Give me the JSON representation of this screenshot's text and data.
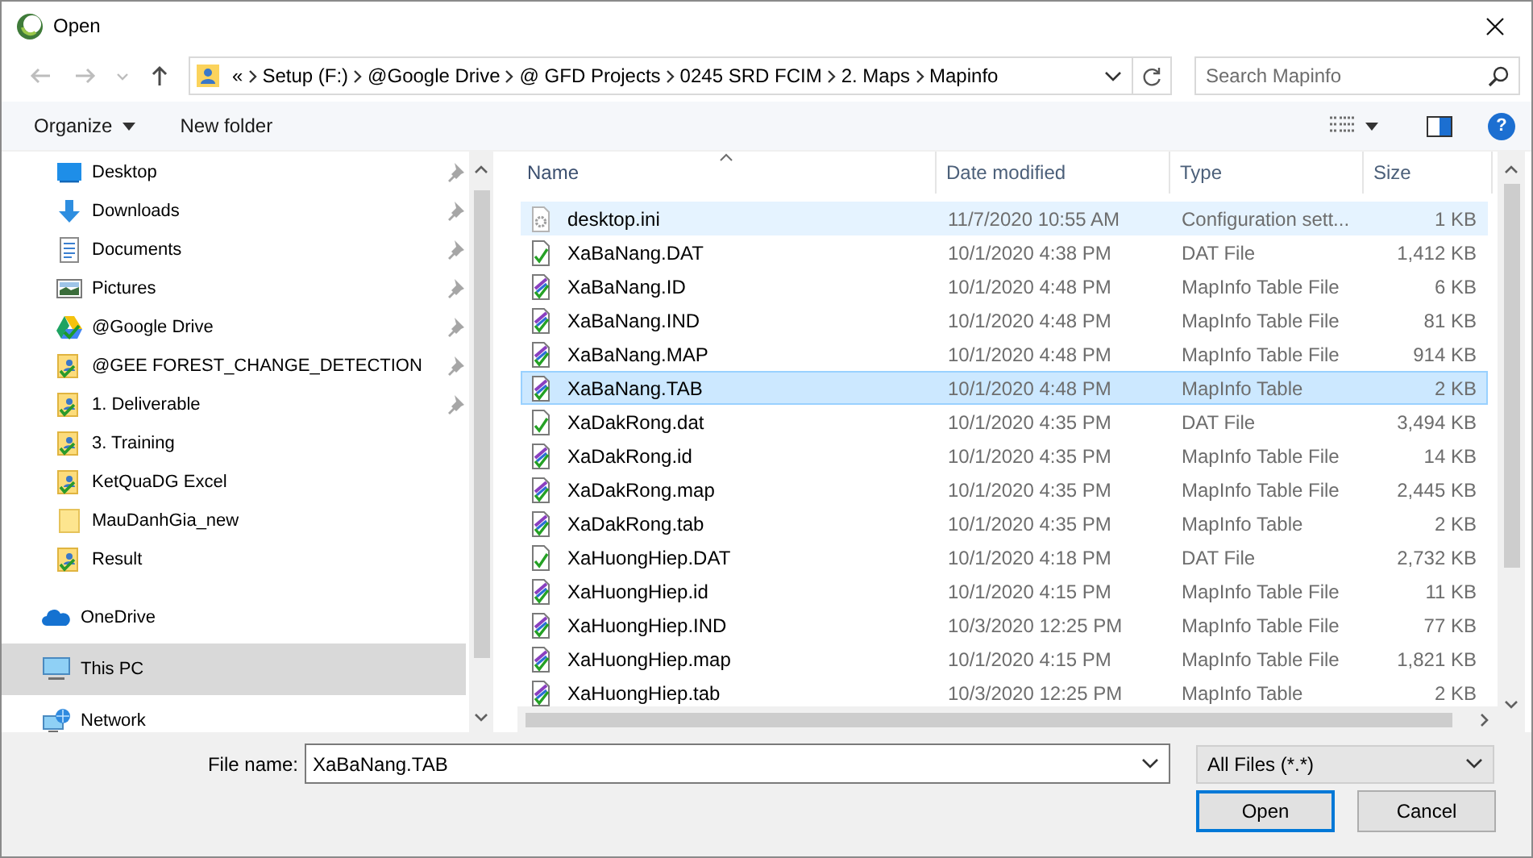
{
  "window": {
    "title": "Open"
  },
  "nav_buttons": [
    {
      "kind": "back",
      "disabled": true
    },
    {
      "kind": "forward",
      "disabled": true
    },
    {
      "kind": "recent",
      "disabled": true
    },
    {
      "kind": "up",
      "disabled": false
    }
  ],
  "address": {
    "overflow": "«",
    "crumbs": [
      "Setup (F:)",
      "@Google Drive",
      "@ GFD Projects",
      "0245 SRD FCIM",
      "2. Maps",
      "Mapinfo"
    ]
  },
  "search": {
    "placeholder": "Search Mapinfo"
  },
  "toolbar": {
    "organize": "Organize",
    "new_folder": "New folder",
    "help": "?"
  },
  "sidebar": {
    "quick_access": [
      {
        "label": "Desktop",
        "kind": "desktop",
        "pinned": true,
        "selected": false
      },
      {
        "label": "Downloads",
        "kind": "downloads",
        "pinned": true,
        "selected": false
      },
      {
        "label": "Documents",
        "kind": "documents",
        "pinned": true,
        "selected": false
      },
      {
        "label": "Pictures",
        "kind": "pictures",
        "pinned": true,
        "selected": false
      },
      {
        "label": "@Google Drive",
        "kind": "drive",
        "pinned": true,
        "selected": false
      },
      {
        "label": "@GEE FOREST_CHANGE_DETECTION",
        "kind": "synced-folder",
        "pinned": true,
        "selected": false
      },
      {
        "label": "1. Deliverable",
        "kind": "synced-folder",
        "pinned": true,
        "selected": false
      },
      {
        "label": "3. Training",
        "kind": "synced-folder",
        "pinned": false,
        "selected": false
      },
      {
        "label": "KetQuaDG Excel",
        "kind": "synced-folder",
        "pinned": false,
        "selected": false
      },
      {
        "label": "MauDanhGia_new",
        "kind": "folder",
        "pinned": false,
        "selected": false
      },
      {
        "label": "Result",
        "kind": "synced-folder",
        "pinned": false,
        "selected": false
      }
    ],
    "locations": [
      {
        "label": "OneDrive",
        "kind": "cloud",
        "selected": false
      },
      {
        "label": "This PC",
        "kind": "pc",
        "selected": true
      },
      {
        "label": "Network",
        "kind": "network",
        "selected": false
      }
    ]
  },
  "columns": [
    {
      "label": "Name",
      "sorted": true
    },
    {
      "label": "Date modified",
      "sorted": false
    },
    {
      "label": "Type",
      "sorted": false
    },
    {
      "label": "Size",
      "sorted": false
    }
  ],
  "rows": [
    {
      "name": "desktop.ini",
      "date": "11/7/2020 10:55 AM",
      "type": "Configuration sett...",
      "size": "1 KB",
      "kind": "settings",
      "selected": false,
      "hovered": true
    },
    {
      "name": "XaBaNang.DAT",
      "date": "10/1/2020 4:38 PM",
      "type": "DAT File",
      "size": "1,412 KB",
      "kind": "data",
      "selected": false,
      "hovered": false
    },
    {
      "name": "XaBaNang.ID",
      "date": "10/1/2020 4:48 PM",
      "type": "MapInfo Table File",
      "size": "6 KB",
      "kind": "map",
      "selected": false,
      "hovered": false
    },
    {
      "name": "XaBaNang.IND",
      "date": "10/1/2020 4:48 PM",
      "type": "MapInfo Table File",
      "size": "81 KB",
      "kind": "map",
      "selected": false,
      "hovered": false
    },
    {
      "name": "XaBaNang.MAP",
      "date": "10/1/2020 4:48 PM",
      "type": "MapInfo Table File",
      "size": "914 KB",
      "kind": "map",
      "selected": false,
      "hovered": false
    },
    {
      "name": "XaBaNang.TAB",
      "date": "10/1/2020 4:48 PM",
      "type": "MapInfo Table",
      "size": "2 KB",
      "kind": "map",
      "selected": true,
      "hovered": false
    },
    {
      "name": "XaDakRong.dat",
      "date": "10/1/2020 4:35 PM",
      "type": "DAT File",
      "size": "3,494 KB",
      "kind": "data",
      "selected": false,
      "hovered": false
    },
    {
      "name": "XaDakRong.id",
      "date": "10/1/2020 4:35 PM",
      "type": "MapInfo Table File",
      "size": "14 KB",
      "kind": "map",
      "selected": false,
      "hovered": false
    },
    {
      "name": "XaDakRong.map",
      "date": "10/1/2020 4:35 PM",
      "type": "MapInfo Table File",
      "size": "2,445 KB",
      "kind": "map",
      "selected": false,
      "hovered": false
    },
    {
      "name": "XaDakRong.tab",
      "date": "10/1/2020 4:35 PM",
      "type": "MapInfo Table",
      "size": "2 KB",
      "kind": "map",
      "selected": false,
      "hovered": false
    },
    {
      "name": "XaHuongHiep.DAT",
      "date": "10/1/2020 4:18 PM",
      "type": "DAT File",
      "size": "2,732 KB",
      "kind": "data",
      "selected": false,
      "hovered": false
    },
    {
      "name": "XaHuongHiep.id",
      "date": "10/1/2020 4:15 PM",
      "type": "MapInfo Table File",
      "size": "11 KB",
      "kind": "map",
      "selected": false,
      "hovered": false
    },
    {
      "name": "XaHuongHiep.IND",
      "date": "10/3/2020 12:25 PM",
      "type": "MapInfo Table File",
      "size": "77 KB",
      "kind": "map",
      "selected": false,
      "hovered": false
    },
    {
      "name": "XaHuongHiep.map",
      "date": "10/1/2020 4:15 PM",
      "type": "MapInfo Table File",
      "size": "1,821 KB",
      "kind": "map",
      "selected": false,
      "hovered": false
    },
    {
      "name": "XaHuongHiep.tab",
      "date": "10/3/2020 12:25 PM",
      "type": "MapInfo Table",
      "size": "2 KB",
      "kind": "map",
      "selected": false,
      "hovered": false
    }
  ],
  "file_name": {
    "label": "File name:",
    "value": "XaBaNang.TAB"
  },
  "file_type": {
    "value": "All Files (*.*)"
  },
  "buttons": [
    {
      "label": "Open",
      "default": true
    },
    {
      "label": "Cancel",
      "default": false
    }
  ]
}
